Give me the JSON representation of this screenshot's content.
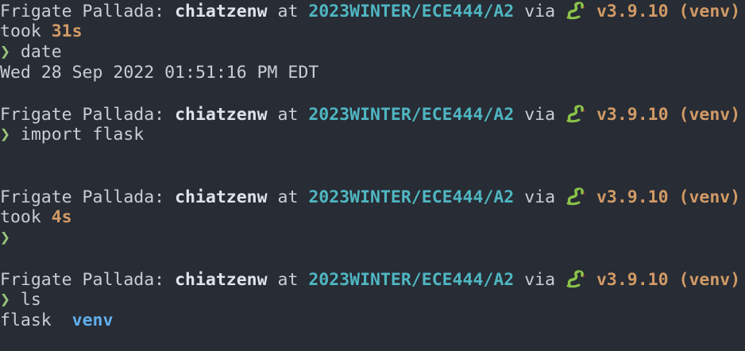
{
  "prompt": {
    "host": "Frigate Pallada:",
    "user": "chiatzenw",
    "at": "at",
    "dir": "2023WINTER/ECE444/A2",
    "via": "via",
    "python_version": "v3.9.10",
    "venv": "(venv)",
    "took": "took",
    "chevron": "❯"
  },
  "blocks": [
    {
      "duration": "31s",
      "command": "date",
      "output": "Wed 28 Sep 2022 01:51:16 PM EDT"
    },
    {
      "command": "import flask"
    },
    {
      "duration": "4s",
      "command": ""
    },
    {
      "command": "ls",
      "output_file": "flask",
      "output_dir": "venv"
    }
  ],
  "icons": {
    "python": "snake-icon"
  },
  "colors": {
    "background": "#282c34",
    "text": "#c9ced6",
    "directory": "#4fb6c2",
    "python": "#d19a66",
    "chevron": "#98c379",
    "dir_listing": "#61afef"
  }
}
